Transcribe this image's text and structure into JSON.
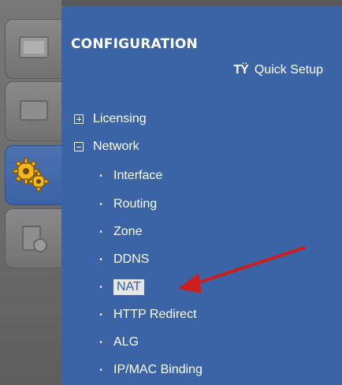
{
  "sidebar": {
    "tabs": [
      {
        "name": "monitor-tab",
        "icon": "monitor-icon",
        "active": false
      },
      {
        "name": "dashboard-tab",
        "icon": "display-icon",
        "active": false
      },
      {
        "name": "configuration-tab",
        "icon": "gears-icon",
        "active": true
      },
      {
        "name": "maintenance-tab",
        "icon": "maintenance-icon",
        "active": false
      }
    ]
  },
  "panel": {
    "title": "CONFIGURATION",
    "quick_setup": {
      "icon": "tools-icon",
      "label": "Quick Setup"
    },
    "tree": [
      {
        "label": "Licensing",
        "expanded": false
      },
      {
        "label": "Network",
        "expanded": true
      }
    ],
    "network_items": [
      {
        "label": "Interface"
      },
      {
        "label": "Routing"
      },
      {
        "label": "Zone"
      },
      {
        "label": "DDNS"
      },
      {
        "label": "NAT",
        "selected": true
      },
      {
        "label": "HTTP Redirect"
      },
      {
        "label": "ALG"
      },
      {
        "label": "IP/MAC Binding"
      }
    ]
  },
  "colors": {
    "panel_bg": "#3a64a6",
    "selected_bg": "#e6e6e6",
    "annotation_arrow": "#cc1e1e"
  }
}
